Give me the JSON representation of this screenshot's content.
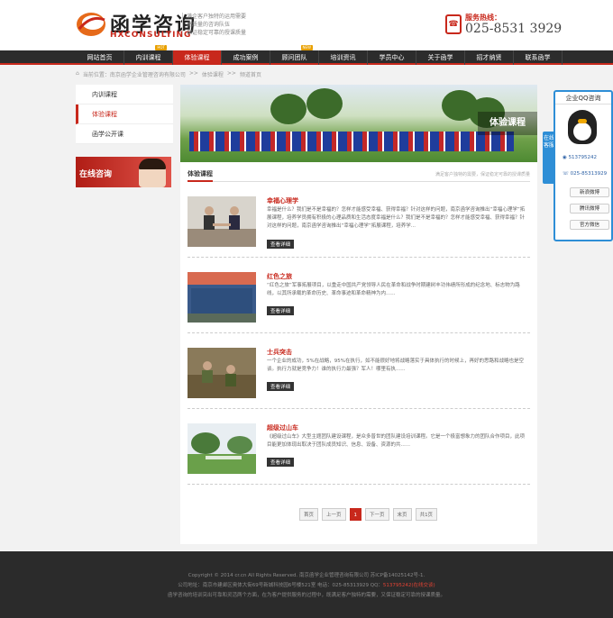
{
  "header": {
    "logo_cn": "函学咨询",
    "logo_en": "HXCONSULTING",
    "slogan": [
      "满企客户独特的运用需要",
      "高质量的咨询队伍",
      "保证稳定可靠的授课质量"
    ],
    "hotline_label": "服务热线：",
    "hotline_number": "025-8531 3929"
  },
  "nav": {
    "items": [
      {
        "label": "网站首页",
        "tag": ""
      },
      {
        "label": "内训课程",
        "tag": "HOT"
      },
      {
        "label": "体验课程",
        "tag": ""
      },
      {
        "label": "成功案例",
        "tag": ""
      },
      {
        "label": "顾问团队",
        "tag": "NEW"
      },
      {
        "label": "培训资讯",
        "tag": ""
      },
      {
        "label": "学员中心",
        "tag": ""
      },
      {
        "label": "关于函学",
        "tag": ""
      },
      {
        "label": "招才纳贤",
        "tag": ""
      },
      {
        "label": "联系函学",
        "tag": ""
      }
    ]
  },
  "breadcrumb": {
    "prefix": "当前位置：南京函学企业管理咨询有限公司",
    "sep1": ">>",
    "level1": "体验课程",
    "sep2": ">>",
    "level2": "频道首页"
  },
  "sidebar": {
    "items": [
      "内训课程",
      "体验课程",
      "函学公开课"
    ],
    "online_label": "在线咨询"
  },
  "banner": {
    "title": "体验课程"
  },
  "section": {
    "title": "体验课程",
    "subtitle": "满足客户独特的需要，保证稳定可靠的授课质量"
  },
  "articles": [
    {
      "title": "幸福心理学",
      "desc": "幸福是什么？我们是不是幸福的？怎样才能感受幸福、获得幸福？针对这样的问题，南京函学咨询推出“幸福心理学”拓展课程，培养学员拥有积极的心理品质和生活态度幸福是什么？我们是不是幸福的？怎样才能感受幸福、获得幸福？针对这样的问题，南京函学咨询推出“幸福心理学”拓展课程，培养学...",
      "more": "查看详细"
    },
    {
      "title": "红色之旅",
      "desc": "“红色之旅”军事拓展项目，以重走中国共产党领导人民在革命和战争时期建树丰功伟绩所形成的纪念地、标志物为路线，以其所承载的革命历史、革命事迹和革命精神为内......",
      "more": "查看详细"
    },
    {
      "title": "士兵突击",
      "desc": "一个企业的成功，5%在战略，95%在执行，如不能很好地将战略落实于具体执行的时候上，再好的思路和战略也是空谈。执行力就是竞争力！谁的执行力最强？军人！哪里有执......",
      "more": "查看详细"
    },
    {
      "title": "超级过山车",
      "desc": "《超级过山车》大型主题团队建设课程，是众多普世的团队建设培训课程。它是一个极富想象力的团队合作项目，此项目能更加体现出取决于团队成员知识、信息、设备、资源的共......",
      "more": "查看详细"
    }
  ],
  "pager": [
    "首页",
    "上一页",
    "1",
    "下一页",
    "末页",
    "共1页"
  ],
  "footer": {
    "line1": "Copyright © 2014 cr.cn All Rights Reserved.    南京函学企业管理咨询有限公司    苏ICP备14025142号-1.",
    "line2_a": "公司地址：南京市建邺区奥体大街69号新城科技园6号楼521室    电话：025-85313929    QQ：",
    "line2_b": "513795242(在线交谈)",
    "line3": "函学咨询的培训突出可靠和灵活两个方面，在为客户提供服务的过程中，既满足客户独特的需要，又保证稳定可靠的授课质量。"
  },
  "qq_panel": {
    "title": "企业QQ咨询",
    "tab": "在线客服",
    "qq_number": "513795242",
    "phone": "025-85313929",
    "buttons": [
      "新浪微博",
      "腾讯微博",
      "官方微信"
    ]
  },
  "colors": {
    "accent": "#c8281c",
    "nav_bg": "#2c2c2c",
    "qq_blue": "#2e8ed6"
  }
}
